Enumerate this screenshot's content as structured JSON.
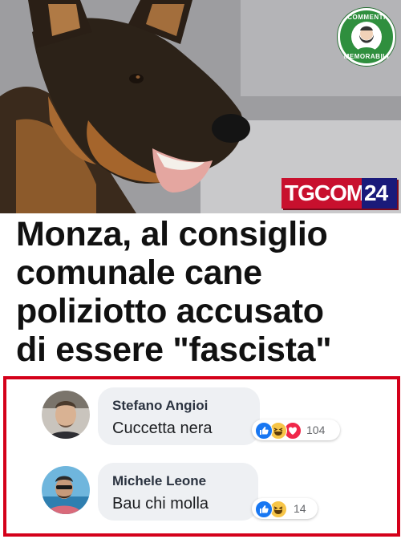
{
  "post": {
    "headline_lines": [
      "Monza, al consiglio",
      "comunale cane",
      "poliziotto accusato",
      "di essere \"fascista\""
    ]
  },
  "badge": {
    "top_text": "COMMENTI",
    "bottom_text": "MEMORABILI",
    "color": "#2f8f3e"
  },
  "broadcaster": {
    "logo_tg": "TGCOM",
    "logo_num": "24",
    "colors": {
      "red": "#c8102e",
      "blue": "#1a1a7a"
    }
  },
  "comments": [
    {
      "author": "Stefano Angioi",
      "text": "Cuccetta nera",
      "reactions": [
        "like-icon",
        "haha-icon",
        "love-icon"
      ],
      "reaction_count": "104"
    },
    {
      "author": "Michele Leone",
      "text": "Bau chi molla",
      "reactions": [
        "like-icon",
        "haha-icon"
      ],
      "reaction_count": "14"
    }
  ],
  "accent": {
    "frame": "#d4001a",
    "like": "#1877f2"
  }
}
